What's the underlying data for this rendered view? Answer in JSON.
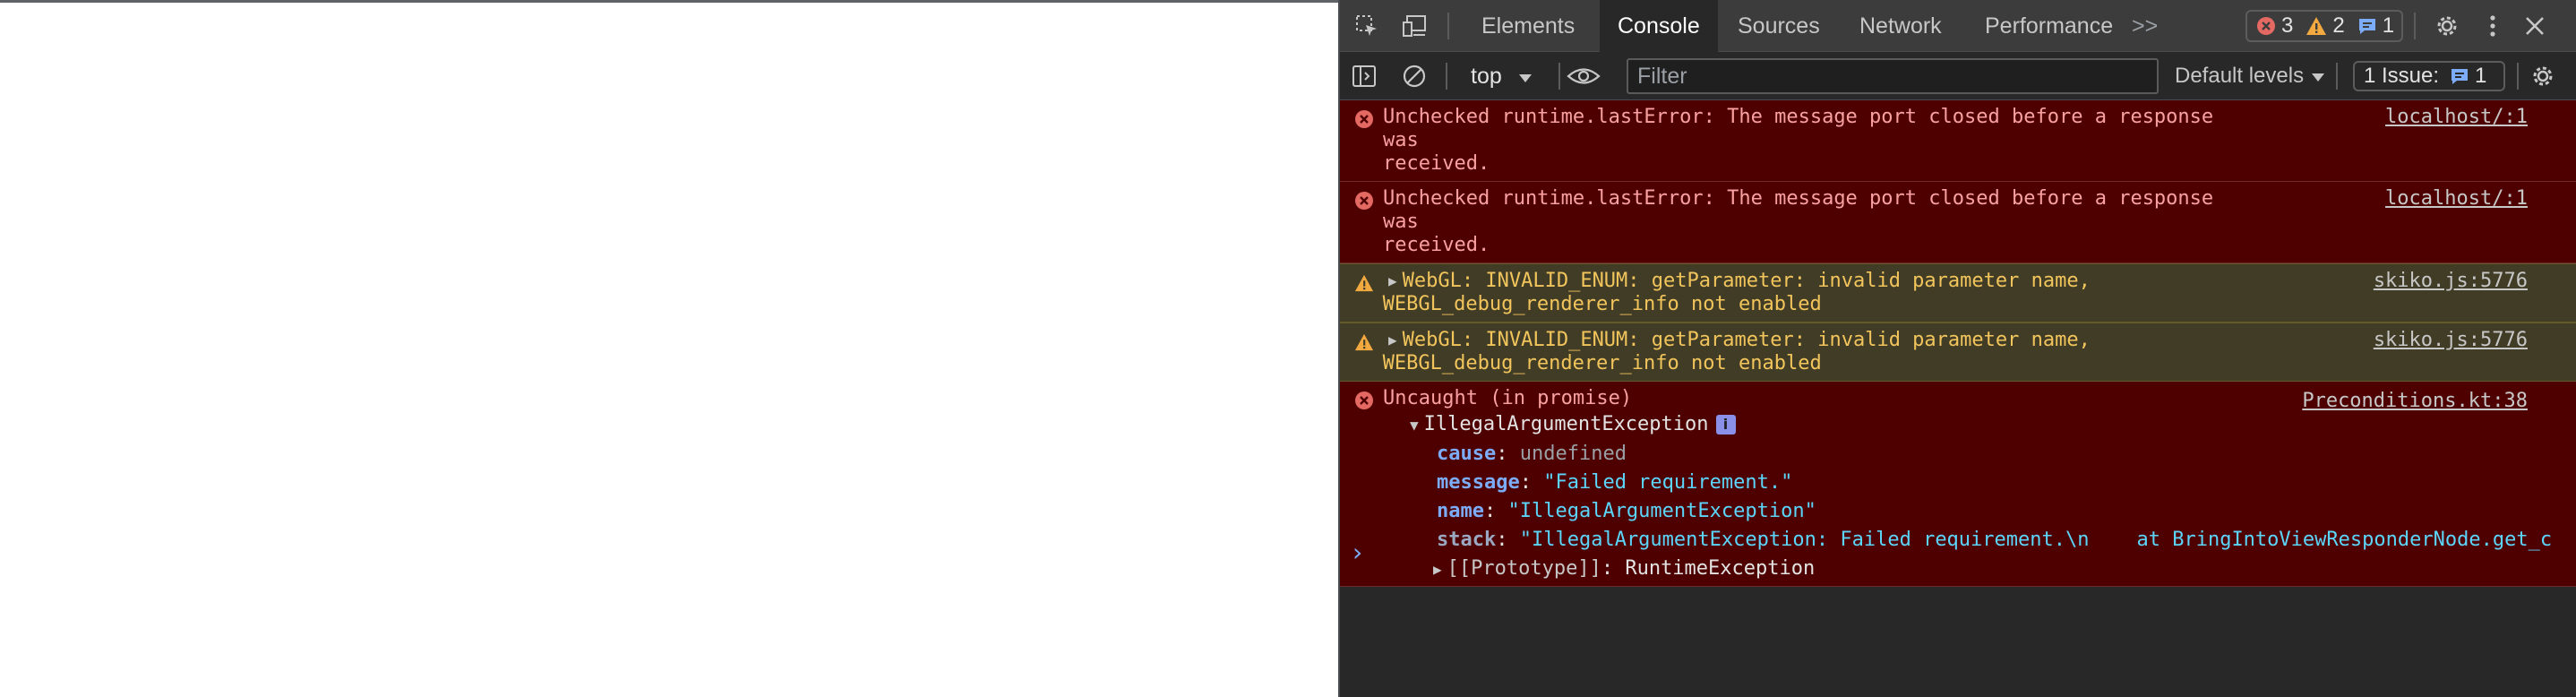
{
  "devtools": {
    "tabs": [
      {
        "label": "Elements"
      },
      {
        "label": "Console"
      },
      {
        "label": "Sources"
      },
      {
        "label": "Network"
      },
      {
        "label": "Performance"
      }
    ],
    "more_tabs": ">>",
    "counters": {
      "errors": "3",
      "warnings": "2",
      "info": "1"
    },
    "toolbar": {
      "context": "top",
      "filter_placeholder": "Filter",
      "levels": "Default levels",
      "issues_label": "1 Issue:",
      "issues_count": "1"
    },
    "messages": [
      {
        "text": "Unchecked runtime.lastError: The message port closed before a response was\nreceived.",
        "source": "localhost/:1"
      },
      {
        "text": "Unchecked runtime.lastError: The message port closed before a response was\nreceived.",
        "source": "localhost/:1"
      },
      {
        "text": "WebGL: INVALID_ENUM: getParameter: invalid parameter name,\nWEBGL_debug_renderer_info not enabled",
        "source": "skiko.js:5776"
      },
      {
        "text": "WebGL: INVALID_ENUM: getParameter: invalid parameter name,\nWEBGL_debug_renderer_info not enabled",
        "source": "skiko.js:5776"
      }
    ],
    "exception": {
      "header": "Uncaught (in promise)",
      "source": "Preconditions.kt:38",
      "object_name": "IllegalArgumentException",
      "props": {
        "cause_key": "cause",
        "cause_val": "undefined",
        "message_key": "message",
        "message_val": "\"Failed requirement.\"",
        "name_key": "name",
        "name_val": "\"IllegalArgumentException\"",
        "stack_key": "stack",
        "stack_val": "\"IllegalArgumentException: Failed requirement.\\n    at BringIntoViewResponderNode.get_c",
        "proto_key": "[[Prototype]]",
        "proto_val": "RuntimeException"
      }
    },
    "prompt": "›",
    "colors": {
      "error_bg": "#4e0000",
      "warn_bg": "#413c26",
      "accent": "#7cacf8"
    }
  }
}
